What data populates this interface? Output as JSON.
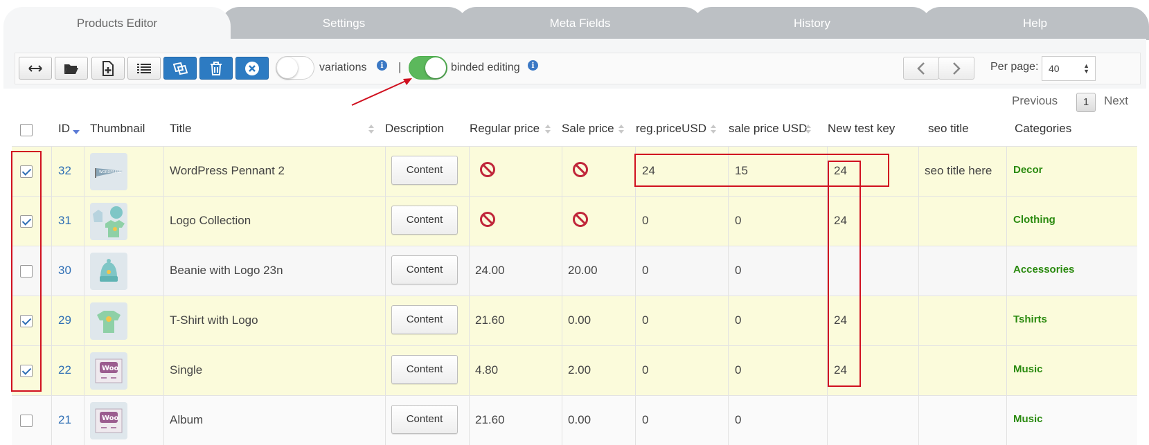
{
  "tabs": [
    {
      "label": "Products Editor",
      "active": true
    },
    {
      "label": "Settings",
      "active": false
    },
    {
      "label": "Meta Fields",
      "active": false
    },
    {
      "label": "History",
      "active": false
    },
    {
      "label": "Help",
      "active": false
    }
  ],
  "toolbar": {
    "buttons": [
      "expand-horizontal-icon",
      "folder-open-icon",
      "add-document-icon",
      "list-icon",
      "duplicate-icon",
      "trash-icon",
      "close-circle-icon"
    ],
    "variations_label": "variations",
    "variations_on": false,
    "separator": "|",
    "binded_label": "binded editing",
    "binded_on": true,
    "info_glyph": "i",
    "per_page_label": "Per page:",
    "per_page_value": "40"
  },
  "pagination": {
    "previous": "Previous",
    "current": "1",
    "next": "Next"
  },
  "columns": {
    "id": "ID",
    "thumbnail": "Thumbnail",
    "title": "Title",
    "description": "Description",
    "regular_price": "Regular price",
    "sale_price": "Sale price",
    "reg_price_usd": "reg.priceUSD",
    "sale_price_usd": "sale price USD",
    "new_test_key": "New test key",
    "seo_title": "seo title",
    "categories": "Categories"
  },
  "content_label": "Content",
  "rows": [
    {
      "checked": true,
      "id": "32",
      "title": "WordPress Pennant 2",
      "regular_price": "",
      "sale_price": "",
      "regular_blocked": true,
      "sale_blocked": true,
      "reg_usd": "24",
      "sale_usd": "15",
      "new_key": "24",
      "seo": "seo title here",
      "category": "Decor",
      "thumb": "pennant"
    },
    {
      "checked": true,
      "id": "31",
      "title": "Logo Collection",
      "regular_price": "",
      "sale_price": "",
      "regular_blocked": true,
      "sale_blocked": true,
      "reg_usd": "0",
      "sale_usd": "0",
      "new_key": "24",
      "seo": "",
      "category": "Clothing",
      "thumb": "collection"
    },
    {
      "checked": false,
      "id": "30",
      "title": "Beanie with Logo 23n",
      "regular_price": "24.00",
      "sale_price": "20.00",
      "regular_blocked": false,
      "sale_blocked": false,
      "reg_usd": "0",
      "sale_usd": "0",
      "new_key": "",
      "seo": "",
      "category": "Accessories",
      "thumb": "beanie"
    },
    {
      "checked": true,
      "id": "29",
      "title": "T-Shirt with Logo",
      "regular_price": "21.60",
      "sale_price": "0.00",
      "regular_blocked": false,
      "sale_blocked": false,
      "reg_usd": "0",
      "sale_usd": "0",
      "new_key": "24",
      "seo": "",
      "category": "Tshirts",
      "thumb": "tshirt"
    },
    {
      "checked": true,
      "id": "22",
      "title": "Single",
      "regular_price": "4.80",
      "sale_price": "2.00",
      "regular_blocked": false,
      "sale_blocked": false,
      "reg_usd": "0",
      "sale_usd": "0",
      "new_key": "24",
      "seo": "",
      "category": "Music",
      "thumb": "woo"
    },
    {
      "checked": false,
      "id": "21",
      "title": "Album",
      "regular_price": "21.60",
      "sale_price": "0.00",
      "regular_blocked": false,
      "sale_blocked": false,
      "reg_usd": "0",
      "sale_usd": "0",
      "new_key": "",
      "seo": "",
      "category": "Music",
      "thumb": "woo"
    }
  ],
  "colors": {
    "selected_row": "#fbfbdb",
    "accent_blue": "#2d7bc2",
    "toggle_on": "#5cb85c",
    "annotation_red": "#d0101f",
    "category_green": "#2a8a0f"
  }
}
